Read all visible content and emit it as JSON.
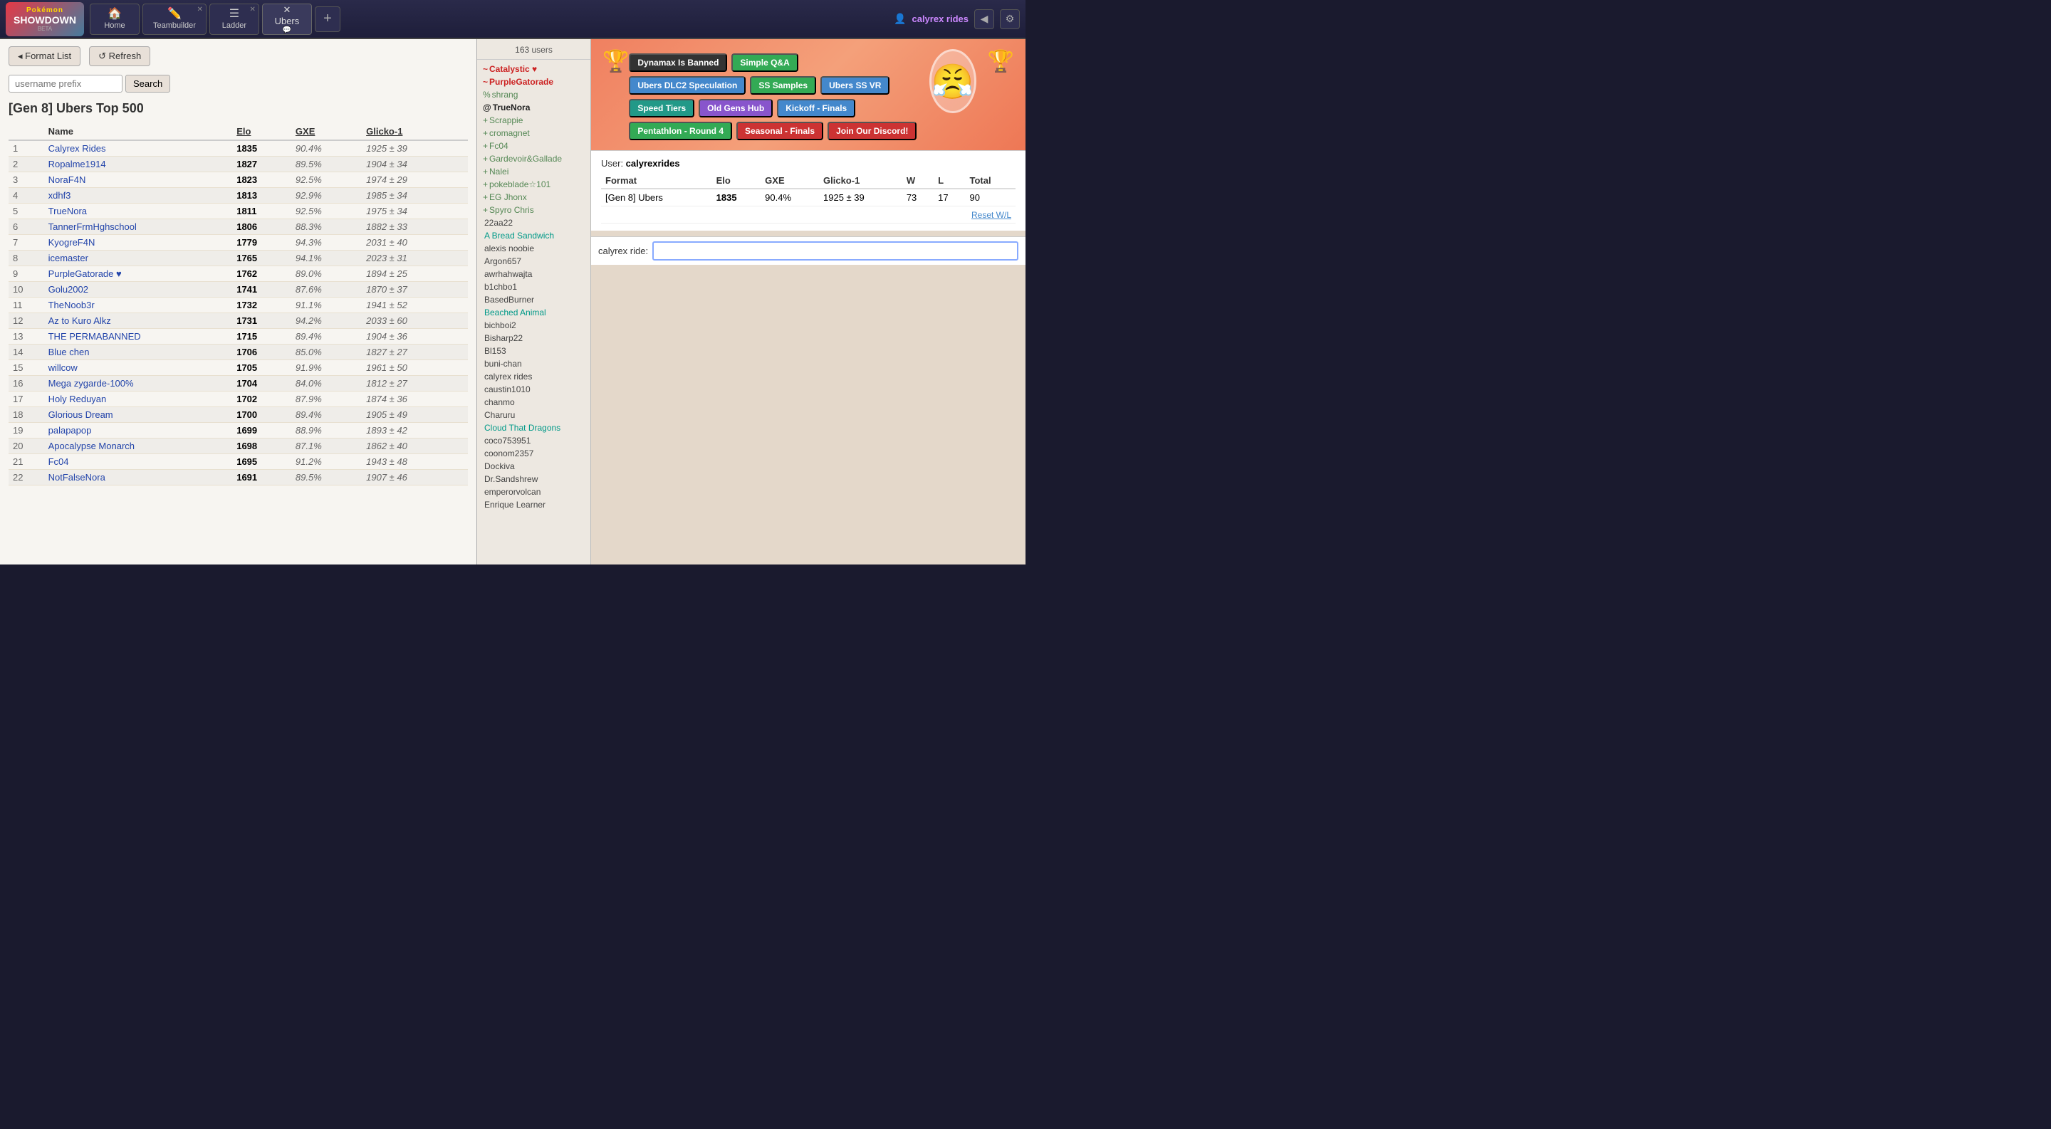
{
  "nav": {
    "logo_pokemon": "Pokémon",
    "logo_showdown": "SHOWDOWN",
    "logo_beta": "BETA",
    "tabs": [
      {
        "label": "Home",
        "icon": "🏠",
        "closeable": false
      },
      {
        "label": "Teambuilder",
        "icon": "✏️",
        "closeable": true
      },
      {
        "label": "Ladder",
        "icon": "☰",
        "closeable": true
      }
    ],
    "ubers_tab": "Ubers",
    "add_tab": "+",
    "username": "calyrex rides",
    "user_icon": "👤"
  },
  "left_panel": {
    "format_list_btn": "◂ Format List",
    "refresh_btn": "↺ Refresh",
    "search_placeholder": "username prefix",
    "search_btn": "Search",
    "title": "[Gen 8] Ubers Top 500",
    "columns": [
      "",
      "Name",
      "Elo",
      "GXE",
      "Glicko-1"
    ],
    "rows": [
      {
        "rank": 1,
        "name": "Calyrex Rides",
        "elo": "1835",
        "gxe": "90.4%",
        "glicko": "1925 ± 39"
      },
      {
        "rank": 2,
        "name": "Ropalme1914",
        "elo": "1827",
        "gxe": "89.5%",
        "glicko": "1904 ± 34"
      },
      {
        "rank": 3,
        "name": "NoraF4N",
        "elo": "1823",
        "gxe": "92.5%",
        "glicko": "1974 ± 29"
      },
      {
        "rank": 4,
        "name": "xdhf3",
        "elo": "1813",
        "gxe": "92.9%",
        "glicko": "1985 ± 34"
      },
      {
        "rank": 5,
        "name": "TrueNora",
        "elo": "1811",
        "gxe": "92.5%",
        "glicko": "1975 ± 34"
      },
      {
        "rank": 6,
        "name": "TannerFrmHghschool",
        "elo": "1806",
        "gxe": "88.3%",
        "glicko": "1882 ± 33"
      },
      {
        "rank": 7,
        "name": "KyogreF4N",
        "elo": "1779",
        "gxe": "94.3%",
        "glicko": "2031 ± 40"
      },
      {
        "rank": 8,
        "name": "icemaster",
        "elo": "1765",
        "gxe": "94.1%",
        "glicko": "2023 ± 31"
      },
      {
        "rank": 9,
        "name": "PurpleGatorade ♥",
        "elo": "1762",
        "gxe": "89.0%",
        "glicko": "1894 ± 25"
      },
      {
        "rank": 10,
        "name": "Golu2002",
        "elo": "1741",
        "gxe": "87.6%",
        "glicko": "1870 ± 37"
      },
      {
        "rank": 11,
        "name": "TheNoob3r",
        "elo": "1732",
        "gxe": "91.1%",
        "glicko": "1941 ± 52"
      },
      {
        "rank": 12,
        "name": "Az to Kuro Alkz",
        "elo": "1731",
        "gxe": "94.2%",
        "glicko": "2033 ± 60"
      },
      {
        "rank": 13,
        "name": "THE PERMABANNED",
        "elo": "1715",
        "gxe": "89.4%",
        "glicko": "1904 ± 36"
      },
      {
        "rank": 14,
        "name": "Blue chen",
        "elo": "1706",
        "gxe": "85.0%",
        "glicko": "1827 ± 27"
      },
      {
        "rank": 15,
        "name": "willcow",
        "elo": "1705",
        "gxe": "91.9%",
        "glicko": "1961 ± 50"
      },
      {
        "rank": 16,
        "name": "Mega zygarde-100%",
        "elo": "1704",
        "gxe": "84.0%",
        "glicko": "1812 ± 27"
      },
      {
        "rank": 17,
        "name": "Holy Reduyan",
        "elo": "1702",
        "gxe": "87.9%",
        "glicko": "1874 ± 36"
      },
      {
        "rank": 18,
        "name": "Glorious Dream",
        "elo": "1700",
        "gxe": "89.4%",
        "glicko": "1905 ± 49"
      },
      {
        "rank": 19,
        "name": "palapapop",
        "elo": "1699",
        "gxe": "88.9%",
        "glicko": "1893 ± 42"
      },
      {
        "rank": 20,
        "name": "Apocalypse Monarch",
        "elo": "1698",
        "gxe": "87.1%",
        "glicko": "1862 ± 40"
      },
      {
        "rank": 21,
        "name": "Fc04",
        "elo": "1695",
        "gxe": "91.2%",
        "glicko": "1943 ± 48"
      },
      {
        "rank": 22,
        "name": "NotFalseNora",
        "elo": "1691",
        "gxe": "89.5%",
        "glicko": "1907 ± 46"
      }
    ]
  },
  "middle_panel": {
    "user_count": "163 users",
    "users": [
      {
        "name": "Catalystic ♥",
        "rank": "~",
        "style": "staff"
      },
      {
        "name": "PurpleGatorade",
        "rank": "~",
        "style": "staff"
      },
      {
        "name": "shrang",
        "rank": "%",
        "style": "voice"
      },
      {
        "name": "TrueNora",
        "rank": "@",
        "style": "bold"
      },
      {
        "name": "Scrappie",
        "rank": "+",
        "style": "voice"
      },
      {
        "name": "cromagnet",
        "rank": "+",
        "style": "voice"
      },
      {
        "name": "Fc04",
        "rank": "+",
        "style": "voice"
      },
      {
        "name": "Gardevoir&Gallade",
        "rank": "+",
        "style": "voice"
      },
      {
        "name": "Nalei",
        "rank": "+",
        "style": "voice"
      },
      {
        "name": "pokeblade☆101",
        "rank": "+",
        "style": "voice"
      },
      {
        "name": "EG Jhonx",
        "rank": "+",
        "style": "voice"
      },
      {
        "name": "Spyro Chris",
        "rank": "+",
        "style": "voice"
      },
      {
        "name": "22aa22",
        "rank": " ",
        "style": "normal"
      },
      {
        "name": "A Bread Sandwich",
        "rank": " ",
        "style": "cyan"
      },
      {
        "name": "alexis noobie",
        "rank": " ",
        "style": "normal"
      },
      {
        "name": "Argon657",
        "rank": " ",
        "style": "normal"
      },
      {
        "name": "awrhahwajta",
        "rank": " ",
        "style": "normal"
      },
      {
        "name": "b1chbo1",
        "rank": " ",
        "style": "normal"
      },
      {
        "name": "BasedBurner",
        "rank": " ",
        "style": "normal"
      },
      {
        "name": "Beached Animal",
        "rank": " ",
        "style": "cyan"
      },
      {
        "name": "bichboi2",
        "rank": " ",
        "style": "normal"
      },
      {
        "name": "Bisharp22",
        "rank": " ",
        "style": "normal"
      },
      {
        "name": "Bl153",
        "rank": " ",
        "style": "normal"
      },
      {
        "name": "buni-chan",
        "rank": " ",
        "style": "normal"
      },
      {
        "name": "calyrex rides",
        "rank": " ",
        "style": "normal"
      },
      {
        "name": "caustin1010",
        "rank": " ",
        "style": "normal"
      },
      {
        "name": "chanmo",
        "rank": " ",
        "style": "normal"
      },
      {
        "name": "Charuru",
        "rank": " ",
        "style": "normal"
      },
      {
        "name": "Cloud That Dragons",
        "rank": " ",
        "style": "cyan"
      },
      {
        "name": "coco753951",
        "rank": " ",
        "style": "normal"
      },
      {
        "name": "coonom2357",
        "rank": " ",
        "style": "normal"
      },
      {
        "name": "Dockiva",
        "rank": " ",
        "style": "normal"
      },
      {
        "name": "Dr.Sandshrew",
        "rank": " ",
        "style": "normal"
      },
      {
        "name": "emperorvolcan",
        "rank": " ",
        "style": "normal"
      },
      {
        "name": "Enrique Learner",
        "rank": " ",
        "style": "normal"
      }
    ]
  },
  "right_panel": {
    "banner": {
      "tags": [
        {
          "text": "Dynamax Is Banned",
          "color": "#333"
        },
        {
          "text": "Simple Q&A",
          "color": "#33aa55"
        },
        {
          "text": "Ubers DLC2 Speculation",
          "color": "#4488cc"
        },
        {
          "text": "SS Samples",
          "color": "#33aa55"
        },
        {
          "text": "Ubers SS VR",
          "color": "#4488cc"
        },
        {
          "text": "Speed Tiers",
          "color": "#229988"
        },
        {
          "text": "Old Gens Hub",
          "color": "#8855cc"
        },
        {
          "text": "Kickoff - Finals",
          "color": "#4488cc"
        },
        {
          "text": "Pentathlon - Round 4",
          "color": "#33aa55"
        },
        {
          "text": "Seasonal - Finals",
          "color": "#cc3333"
        },
        {
          "text": "Join Our Discord!",
          "color": "#cc3333"
        }
      ],
      "mascot_emoji": "😤",
      "poke_left_emoji": "🏆",
      "poke_right_emoji": "🏆"
    },
    "user_stats": {
      "label": "User:",
      "username": "calyrexrides",
      "columns": [
        "Format",
        "Elo",
        "GXE",
        "Glicko-1",
        "W",
        "L",
        "Total"
      ],
      "row": {
        "format": "[Gen 8] Ubers",
        "elo": "1835",
        "gxe": "90.4%",
        "glicko": "1925 ± 39",
        "w": "73",
        "l": "17",
        "total": "90"
      },
      "reset_link": "Reset W/L"
    },
    "chat_input": {
      "username_label": "calyrex ride:",
      "placeholder": ""
    }
  }
}
